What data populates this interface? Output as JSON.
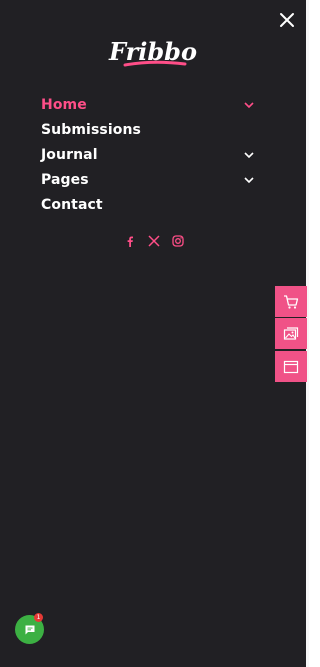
{
  "brand": {
    "logo_text": "Fribbo"
  },
  "menu": {
    "items": [
      {
        "label": "Home",
        "active": true,
        "has_submenu": true
      },
      {
        "label": "Submissions",
        "active": false,
        "has_submenu": false
      },
      {
        "label": "Journal",
        "active": false,
        "has_submenu": true
      },
      {
        "label": "Pages",
        "active": false,
        "has_submenu": true
      },
      {
        "label": "Contact",
        "active": false,
        "has_submenu": false
      }
    ]
  },
  "social": [
    "facebook-icon",
    "x-icon",
    "instagram-icon"
  ],
  "side_buttons": [
    "cart-icon",
    "gallery-icon",
    "browser-window-icon"
  ],
  "chat": {
    "badge_count": "1"
  },
  "colors": {
    "panel_bg": "#212024",
    "accent": "#ff4e88",
    "side_button": "#f05287",
    "chat": "#3cb043"
  }
}
